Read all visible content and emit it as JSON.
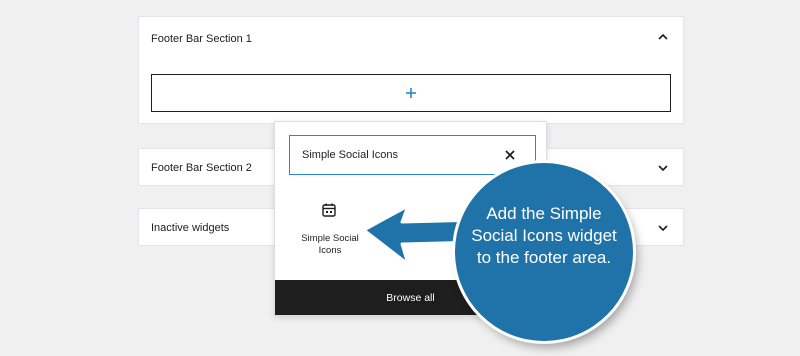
{
  "sections": [
    {
      "title": "Footer Bar Section 1",
      "state": "expanded",
      "appender_icon": "plus-icon"
    },
    {
      "title": "Footer Bar Section 2",
      "state": "collapsed"
    },
    {
      "title": "Inactive widgets",
      "state": "collapsed"
    }
  ],
  "inserter": {
    "search_value": "Simple Social Icons",
    "clear_icon": "close-icon",
    "block": {
      "label": "Simple Social Icons",
      "icon": "calendar-icon"
    },
    "browse_all": "Browse all"
  },
  "callout": {
    "text": "Add the Simple Social Icons widget to the footer area.",
    "color": "#1f73a8"
  },
  "colors": {
    "accent": "#2a88c4",
    "dark": "#1e1e1e",
    "background": "#f0f0f1"
  }
}
